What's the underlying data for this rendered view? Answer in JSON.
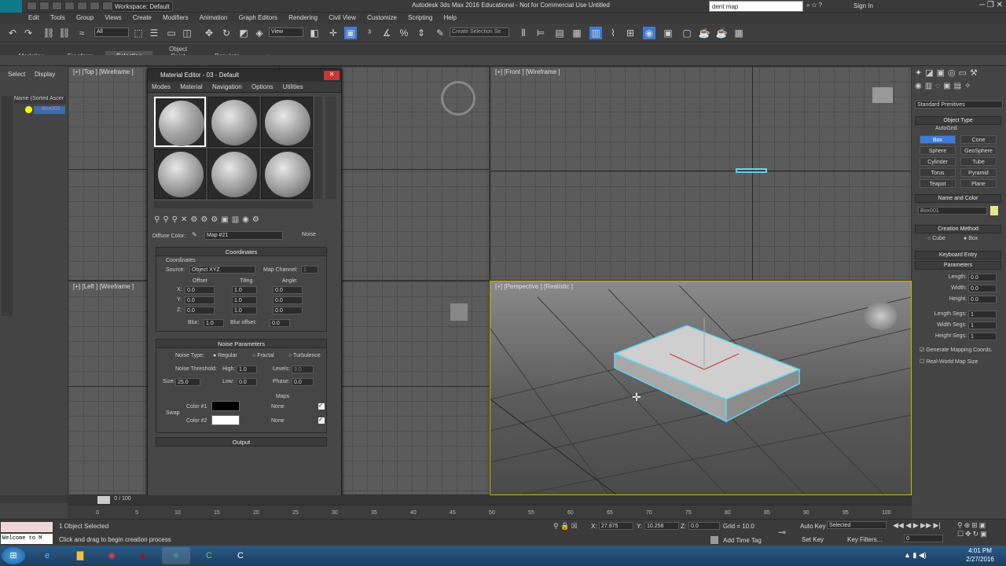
{
  "window": {
    "title": "Autodesk 3ds Max 2016 Educational - Not for Commercial Use   Untitled",
    "workspace": "Workspace: Default",
    "search_value": "dent map",
    "sign_in": "Sign In",
    "logo": "MAX"
  },
  "menus": [
    "Edit",
    "Tools",
    "Group",
    "Views",
    "Create",
    "Modifiers",
    "Animation",
    "Graph Editors",
    "Rendering",
    "Civil View",
    "Customize",
    "Scripting",
    "Help"
  ],
  "toolbar": {
    "filter": "All",
    "ref_coord": "View",
    "named_sel": "Create Selection Se"
  },
  "ribbon_tabs": [
    "Modeling",
    "Freeform",
    "Selection",
    "Object Paint",
    "Populate"
  ],
  "ribbon_active": "Selection",
  "scene_explorer": {
    "tabs": [
      "Select",
      "Display"
    ],
    "header": "Name (Sorted Ascer",
    "item": "Box001"
  },
  "viewports": {
    "top": "[+] [Top ] [Wireframe ]",
    "front": "[+] [Front ] [Wireframe ]",
    "left": "[+] [Left ] [Wireframe ]",
    "perspective": "[+] [Perspective ] [Realistic ]"
  },
  "material_editor": {
    "title": "Material Editor - 03 - Default",
    "menus": [
      "Modes",
      "Material",
      "Navigation",
      "Options",
      "Utilities"
    ],
    "diffuse_label": "Diffuse Color:",
    "map_name": "Map #21",
    "map_type": "Noise",
    "coordinates": {
      "rollout": "Coordinates",
      "group": "Coordinates",
      "source_label": "Source:",
      "source_value": "Object XYZ",
      "map_channel_label": "Map Channel:",
      "map_channel": "1",
      "col_offset": "Offset",
      "col_tiling": "Tiling",
      "col_angle": "Angle:",
      "rows": [
        {
          "axis": "X:",
          "offset": "0.0",
          "tiling": "1.0",
          "angle": "0.0"
        },
        {
          "axis": "Y:",
          "offset": "0.0",
          "tiling": "1.0",
          "angle": "0.0"
        },
        {
          "axis": "Z:",
          "offset": "0.0",
          "tiling": "1.0",
          "angle": "0.0"
        }
      ],
      "blur_label": "Blur:",
      "blur": "1.0",
      "blur_offset_label": "Blur offset:",
      "blur_offset": "0.0"
    },
    "noise": {
      "rollout": "Noise Parameters",
      "type_label": "Noise Type:",
      "types": [
        "Regular",
        "Fractal",
        "Turbulence"
      ],
      "threshold_label": "Noise Threshold:",
      "high_label": "High:",
      "high": "1.0",
      "levels_label": "Levels:",
      "levels": "3.0",
      "size_label": "Size:",
      "size": "25.0",
      "low_label": "Low:",
      "low": "0.0",
      "phase_label": "Phase:",
      "phase": "0.0",
      "maps_label": "Maps",
      "swap_label": "Swap",
      "color1_label": "Color #1",
      "color2_label": "Color #2",
      "map1": "None",
      "map2": "None",
      "color1": "#000000",
      "color2": "#ffffff"
    },
    "output": "Output"
  },
  "command_panel": {
    "category": "Standard Primitives",
    "object_type": "Object Type",
    "autogrid": "AutoGrid",
    "buttons": [
      "Box",
      "Cone",
      "Sphere",
      "GeoSphere",
      "Cylinder",
      "Tube",
      "Torus",
      "Pyramid",
      "Teapot",
      "Plane"
    ],
    "name_color": "Name and Color",
    "object_name": "Box001",
    "creation_method": "Creation Method",
    "cm_options": [
      "Cube",
      "Box"
    ],
    "keyboard_entry": "Keyboard Entry",
    "parameters": "Parameters",
    "params": [
      {
        "label": "Length:",
        "value": "0.0"
      },
      {
        "label": "Width:",
        "value": "0.0"
      },
      {
        "label": "Height:",
        "value": "0.0"
      },
      {
        "label": "Length Segs:",
        "value": "1"
      },
      {
        "label": "Width Segs:",
        "value": "1"
      },
      {
        "label": "Height Segs:",
        "value": "1"
      }
    ],
    "gen_mapping": "Generate Mapping Coords.",
    "real_world": "Real-World Map Size"
  },
  "timeline": {
    "frame": "0 / 100",
    "ticks": [
      "0",
      "5",
      "10",
      "15",
      "20",
      "25",
      "30",
      "35",
      "40",
      "45",
      "50",
      "55",
      "60",
      "65",
      "70",
      "75",
      "80",
      "85",
      "90",
      "95",
      "100"
    ]
  },
  "status": {
    "maxscript": "Welcome to M",
    "selected": "1 Object Selected",
    "prompt": "Click and drag to begin creation process",
    "x_label": "X:",
    "x": "27.875",
    "y_label": "Y:",
    "y": "10.258",
    "z_label": "Z:",
    "z": "0.0",
    "grid": "Grid = 10.0",
    "add_time_tag": "Add Time Tag",
    "auto_key": "Auto Key",
    "set_key": "Set Key",
    "selected_dropdown": "Selected",
    "key_filters": "Key Filters...",
    "frame_field": "0"
  },
  "clock": {
    "time": "4:01 PM",
    "date": "2/27/2016"
  }
}
